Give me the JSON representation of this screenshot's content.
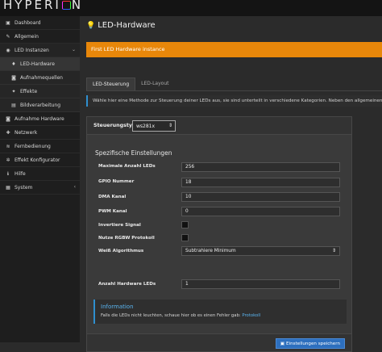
{
  "app": {
    "logo_text": "HYPERI",
    "logo_text_end": "N"
  },
  "sidebar": {
    "items": [
      {
        "label": "Dashboard",
        "icon": "dashboard-icon",
        "glyph": "▣"
      },
      {
        "label": "Allgemein",
        "icon": "wrench-icon",
        "glyph": "✎"
      },
      {
        "label": "LED Instanzen",
        "icon": "lightbulb-icon",
        "glyph": "◉"
      },
      {
        "label": "LED-Hardware",
        "icon": "lightbulb-icon",
        "glyph": "♦"
      },
      {
        "label": "Aufnahmequellen",
        "icon": "camera-icon",
        "glyph": "◙"
      },
      {
        "label": "Effekte",
        "icon": "sparkle-icon",
        "glyph": "✦"
      },
      {
        "label": "Bildverarbeitung",
        "icon": "image-icon",
        "glyph": "▤"
      },
      {
        "label": "Aufnahme Hardware",
        "icon": "camera-icon",
        "glyph": "◙"
      },
      {
        "label": "Netzwerk",
        "icon": "network-icon",
        "glyph": "✚"
      },
      {
        "label": "Fernbedienung",
        "icon": "wifi-icon",
        "glyph": "≋"
      },
      {
        "label": "Effekt Konfigurator",
        "icon": "gears-icon",
        "glyph": "✲"
      },
      {
        "label": "Hilfe",
        "icon": "info-icon",
        "glyph": "ℹ"
      },
      {
        "label": "System",
        "icon": "server-icon",
        "glyph": "▦"
      }
    ]
  },
  "page": {
    "title": "LED-Hardware",
    "banner": "First LED Hardware instance",
    "tabs": [
      "LED-Steuerung",
      "LED-Layout"
    ],
    "intro": "Wähle hier eine Methode zur Steuerung deiner LEDs aus, sie sind unterteilt in verschiedene Kategorien. Neben den allgemeinen Opti"
  },
  "controller": {
    "label": "Steuerungstyp:",
    "value": "ws281x"
  },
  "settings": {
    "title": "Spezifische Einstellungen",
    "fields": {
      "max_leds": {
        "label": "Maximale Anzahl LEDs",
        "value": "256"
      },
      "gpio": {
        "label": "GPIO Nummer",
        "value": "18"
      },
      "dma": {
        "label": "DMA Kanal",
        "value": "10"
      },
      "pwm": {
        "label": "PWM Kanal",
        "value": "0"
      },
      "invert": {
        "label": "Invertiere Signal",
        "checked": false
      },
      "rgbw": {
        "label": "Nutze RGBW Protokoll",
        "checked": false
      },
      "white_algo": {
        "label": "Weiß Algorithmus",
        "value": "Subtrahiere Minimum"
      },
      "hw_leds": {
        "label": "Anzahl Hardware LEDs",
        "value": "1"
      }
    }
  },
  "info": {
    "title": "Information",
    "text": "Falls die LEDs nicht leuchten, schaue hier ob es einen Fehler gab:",
    "link": "Protokoll"
  },
  "save_label": "Einstellungen speichern"
}
